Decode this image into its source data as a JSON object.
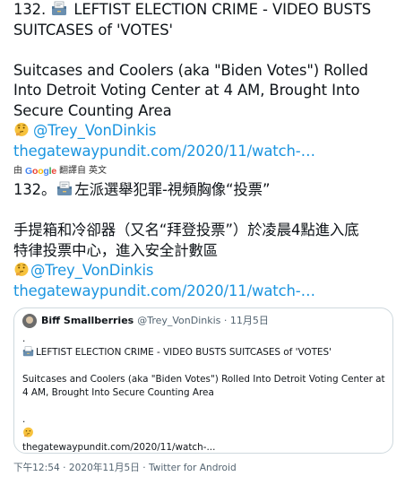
{
  "tweet": {
    "line1_prefix": "132.",
    "line1_rest": "LEFTIST ELECTION CRIME - VIDEO BUSTS",
    "line2": "SUITCASES of 'VOTES'",
    "para_line1": "Suitcases and Coolers (aka \"Biden Votes\") Rolled",
    "para_line2": "Into Detroit Voting Center at 4 AM, Brought Into",
    "para_line3": "Secure Counting Area",
    "mention": "@Trey_VonDinkis",
    "url": "thegatewaypundit.com/2020/11/watch-…"
  },
  "translation_bar": {
    "by": "由",
    "google": "Google",
    "translated_from": "翻譯自",
    "language": "英文"
  },
  "translated": {
    "line1_prefix": "132。",
    "line1_rest": "左派選舉犯罪-視頻胸像“投票”",
    "para_line1": "手提箱和冷卻器（又名“拜登投票”）於凌晨4點進入底",
    "para_line2": "特律投票中心，進入安全計數區",
    "mention": "@Trey_VonDinkis",
    "url": "thegatewaypundit.com/2020/11/watch-…"
  },
  "quote": {
    "name": "Biff Smallberries",
    "handle": "@Trey_VonDinkis",
    "separator": "·",
    "date": "11月5日",
    "dot1": ".",
    "title": "LEFTIST ELECTION CRIME - VIDEO BUSTS SUITCASES of 'VOTES'",
    "body_line1": "Suitcases and Coolers (aka \"Biden Votes\") Rolled Into Detroit Voting Center at",
    "body_line2": "4 AM, Brought Into Secure Counting Area",
    "dot2": ".",
    "url": "thegatewaypundit.com/2020/11/watch-..."
  },
  "footer": {
    "time": "下午12:54",
    "sep1": "·",
    "date": "2020年11月5日",
    "sep2": "·",
    "source": "Twitter for Android"
  },
  "colors": {
    "link": "#1b95e0",
    "text": "#0f1419",
    "muted": "#536471",
    "border": "#cfd9de"
  },
  "icons": [
    "ballot-box-icon",
    "thinking-face-icon",
    "avatar"
  ]
}
